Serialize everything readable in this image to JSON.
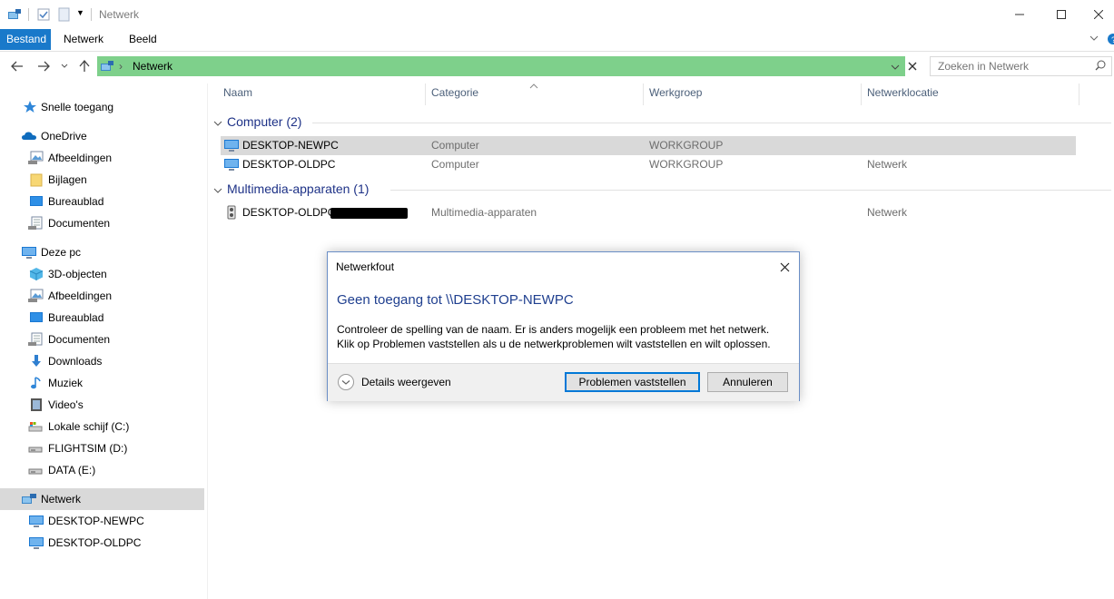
{
  "window": {
    "title": "Netwerk"
  },
  "ribbon": {
    "tabs": [
      "Bestand",
      "Netwerk",
      "Beeld"
    ]
  },
  "address": {
    "path": "Netwerk"
  },
  "search": {
    "placeholder": "Zoeken in Netwerk"
  },
  "sidebar": {
    "items": [
      {
        "label": "Snelle toegang",
        "icon": "star-icon"
      },
      {
        "label": "OneDrive",
        "icon": "cloud-icon"
      },
      {
        "label": "Afbeeldingen",
        "icon": "pictures-icon"
      },
      {
        "label": "Bijlagen",
        "icon": "folder-icon"
      },
      {
        "label": "Bureaublad",
        "icon": "desktop-icon"
      },
      {
        "label": "Documenten",
        "icon": "documents-icon"
      },
      {
        "label": "Deze pc",
        "icon": "computer-icon"
      },
      {
        "label": "3D-objecten",
        "icon": "cube-icon"
      },
      {
        "label": "Afbeeldingen",
        "icon": "pictures-icon"
      },
      {
        "label": "Bureaublad",
        "icon": "desktop-icon"
      },
      {
        "label": "Documenten",
        "icon": "documents-icon"
      },
      {
        "label": "Downloads",
        "icon": "download-icon"
      },
      {
        "label": "Muziek",
        "icon": "music-icon"
      },
      {
        "label": "Video's",
        "icon": "video-icon"
      },
      {
        "label": "Lokale schijf (C:)",
        "icon": "drive-icon"
      },
      {
        "label": "FLIGHTSIM (D:)",
        "icon": "drive-icon"
      },
      {
        "label": "DATA (E:)",
        "icon": "drive-icon"
      },
      {
        "label": "Netwerk",
        "icon": "network-icon"
      },
      {
        "label": "DESKTOP-NEWPC",
        "icon": "computer-icon"
      },
      {
        "label": "DESKTOP-OLDPC",
        "icon": "computer-icon"
      }
    ]
  },
  "columns": [
    "Naam",
    "Categorie",
    "Werkgroep",
    "Netwerklocatie"
  ],
  "groups": [
    {
      "title": "Computer (2)",
      "rows": [
        {
          "name": "DESKTOP-NEWPC",
          "category": "Computer",
          "workgroup": "WORKGROUP",
          "location": ""
        },
        {
          "name": "DESKTOP-OLDPC",
          "category": "Computer",
          "workgroup": "WORKGROUP",
          "location": "Netwerk"
        }
      ]
    },
    {
      "title": "Multimedia-apparaten (1)",
      "rows": [
        {
          "name": "DESKTOP-OLDPC:",
          "category": "Multimedia-apparaten",
          "workgroup": "",
          "location": "Netwerk"
        }
      ]
    }
  ],
  "dialog": {
    "title": "Netwerkfout",
    "heading": "Geen toegang tot \\\\DESKTOP-NEWPC",
    "message": "Controleer de spelling van de naam. Er is anders mogelijk een probleem met het netwerk. Klik op Problemen vaststellen als u de netwerkproblemen wilt vaststellen en wilt oplossen.",
    "details_label": "Details weergeven",
    "primary_button": "Problemen vaststellen",
    "cancel_button": "Annuleren"
  },
  "colors": {
    "accent": "#1979ca",
    "address_bg": "#7ed08b",
    "selection": "#d9d9d9",
    "group_title": "#1e3287"
  }
}
